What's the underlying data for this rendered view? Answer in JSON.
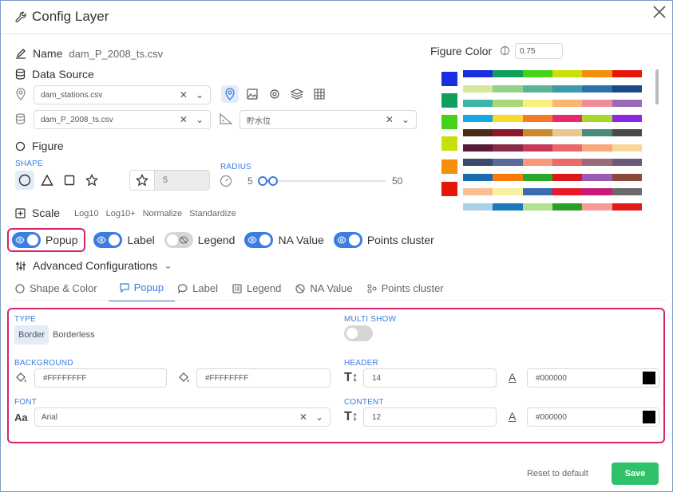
{
  "window": {
    "title": "Config Layer"
  },
  "name": {
    "label": "Name",
    "value": "dam_P_2008_ts.csv"
  },
  "data_source": {
    "label": "Data Source",
    "stations_select": "dam_stations.csv",
    "data_select": "dam_P_2008_ts.csv",
    "variable_select": "貯水位"
  },
  "figure": {
    "label": "Figure",
    "shape_label": "SHAPE",
    "size_value": "5",
    "radius_label": "RADIUS",
    "radius_min": "5",
    "radius_max": "50"
  },
  "scale": {
    "label": "Scale",
    "options": [
      "Log10",
      "Log10+",
      "Normalize",
      "Standardize"
    ]
  },
  "figure_color": {
    "label": "Figure Color",
    "opacity": "0.75"
  },
  "palette_rows": [
    [
      "#1a2de0",
      "#0ea05a",
      "#46d11a",
      "#c8e00a",
      "#f58e0a",
      "#e8160a"
    ],
    [
      "#d6e89a",
      "#92d28a",
      "#5ab49a",
      "#3b9aa8",
      "#2a73a8",
      "#1a4a8a"
    ],
    [
      "#3ab6a8",
      "#a8d878",
      "#f8f07a",
      "#f8b872",
      "#f08c9a",
      "#9a6ab8"
    ],
    [
      "#18a8e8",
      "#f8d82a",
      "#f47a2a",
      "#e82a6a",
      "#a8d828",
      "#8a2ae0"
    ],
    [
      "#4a2a1a",
      "#8a1a2a",
      "#c88a2a",
      "#e8c890",
      "#4a8a7a",
      "#4a4a4a"
    ],
    [
      "#5a1a3a",
      "#8a2a4a",
      "#c83a5a",
      "#e86a6a",
      "#f8a87a",
      "#f8d89a"
    ],
    [
      "#3a4a6a",
      "#5a6a9a",
      "#f89a7a",
      "#e86a6a",
      "#9a6a7a",
      "#6a5a7a"
    ],
    [
      "#1a6ab0",
      "#f87a0a",
      "#2aa82a",
      "#d81a1a",
      "#9a5ab8",
      "#8a4a3a"
    ],
    [
      "#f8c090",
      "#f8f0a0",
      "#3a6ab0",
      "#e81a2a",
      "#c81a7a",
      "#6a6a6a"
    ],
    [
      "#a8d0e8",
      "#1a7ab8",
      "#b0e090",
      "#2aa02a",
      "#f89a9a",
      "#e01a1a"
    ]
  ],
  "swatches": [
    "#1a2de0",
    "#0ea05a",
    "#46d11a",
    "#c8e00a",
    "#f58e0a",
    "#e8160a"
  ],
  "toggles": {
    "popup": {
      "label": "Popup",
      "on": true
    },
    "label": {
      "label": "Label",
      "on": true
    },
    "legend": {
      "label": "Legend",
      "on": false
    },
    "na_value": {
      "label": "NA Value",
      "on": true
    },
    "points_cluster": {
      "label": "Points cluster",
      "on": true
    }
  },
  "advanced": {
    "label": "Advanced Configurations"
  },
  "tabs": [
    "Shape & Color",
    "Popup",
    "Label",
    "Legend",
    "NA Value",
    "Points cluster"
  ],
  "popup_panel": {
    "type_label": "TYPE",
    "type_options": [
      "Border",
      "Borderless"
    ],
    "multi_show_label": "MULTI SHOW",
    "background_label": "BACKGROUND",
    "bg_color_1": "#FFFFFFFF",
    "bg_color_2": "#FFFFFFFF",
    "header_label": "HEADER",
    "header_size": "14",
    "header_color": "#000000",
    "font_label": "FONT",
    "font_value": "Arial",
    "content_label": "CONTENT",
    "content_size": "12",
    "content_color": "#000000"
  },
  "footer": {
    "reset": "Reset to default",
    "save": "Save"
  }
}
